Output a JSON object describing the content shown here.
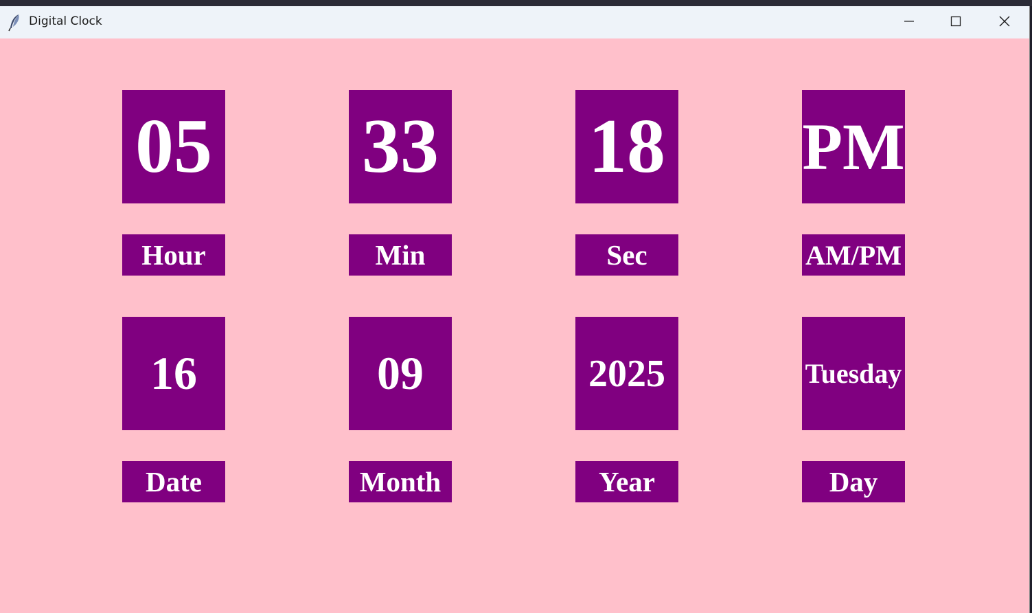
{
  "window": {
    "title": "Digital Clock",
    "icons": {
      "app": "feather-icon",
      "minimize": "minimize-icon",
      "maximize": "maximize-icon",
      "close": "close-icon"
    }
  },
  "colors": {
    "background": "#ffc0cb",
    "tile": "#800080",
    "text": "#ffffff"
  },
  "time": {
    "hour": "05",
    "hour_label": "Hour",
    "minute": "33",
    "minute_label": "Min",
    "second": "18",
    "second_label": "Sec",
    "ampm": "PM",
    "ampm_label": "AM/PM"
  },
  "date": {
    "date": "16",
    "date_label": "Date",
    "month": "09",
    "month_label": "Month",
    "year": "2025",
    "year_label": "Year",
    "day": "Tuesday",
    "day_label": "Day"
  }
}
